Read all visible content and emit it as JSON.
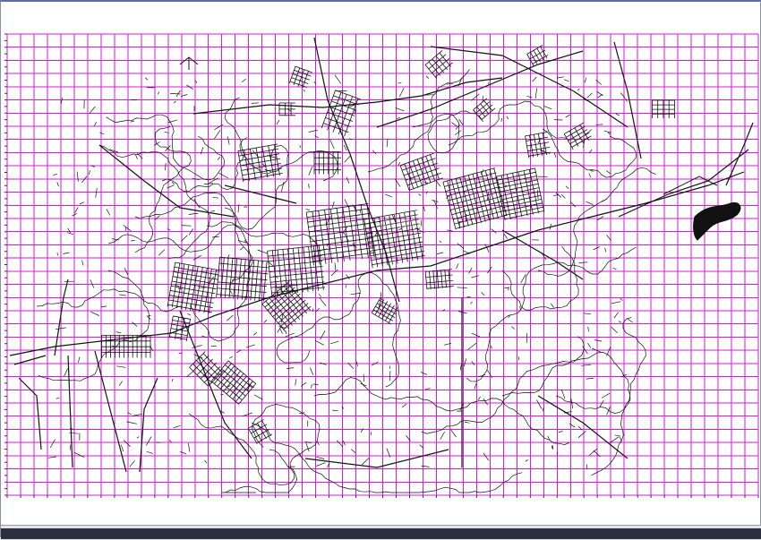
{
  "colors": {
    "background": "#ffffff",
    "grid": "#d61ad6",
    "linework": "#111111",
    "frame": "#5a6ea8",
    "taskbar": "#2a3140"
  },
  "map": {
    "kind": "cad-city-plan",
    "grid": "on",
    "grid_columns": 56,
    "grid_rows": 35
  }
}
